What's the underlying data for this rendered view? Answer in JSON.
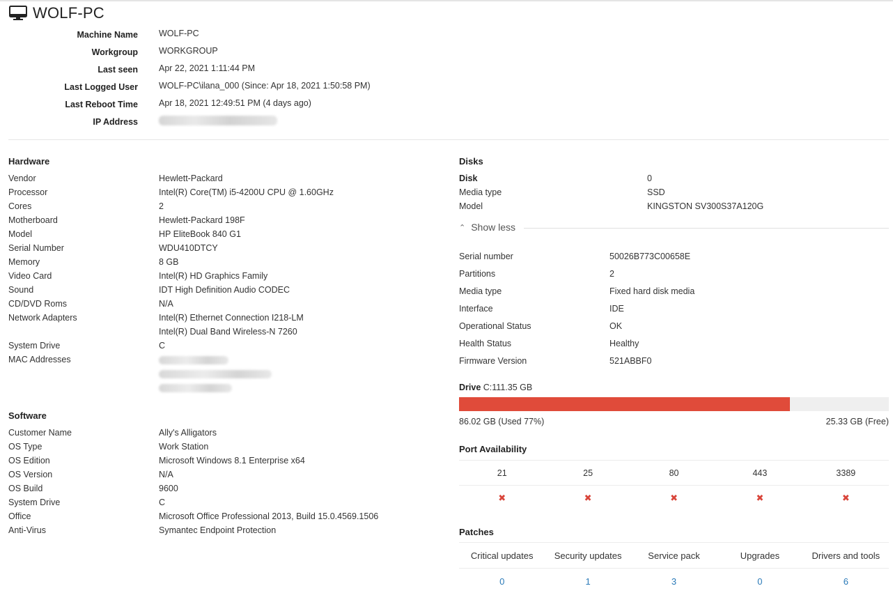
{
  "header": {
    "title": "WOLF-PC",
    "icon": "monitor-icon"
  },
  "summary": [
    {
      "label": "Machine Name",
      "value": "WOLF-PC"
    },
    {
      "label": "Workgroup",
      "value": "WORKGROUP"
    },
    {
      "label": "Last seen",
      "value": "Apr 22, 2021 1:11:44 PM"
    },
    {
      "label": "Last Logged User",
      "value": "WOLF-PC\\ilana_000 (Since: Apr 18, 2021 1:50:58 PM)"
    },
    {
      "label": "Last Reboot Time",
      "value": "Apr 18, 2021 12:49:51 PM (4 days ago)"
    },
    {
      "label": "IP Address",
      "value": ""
    }
  ],
  "hardware": {
    "title": "Hardware",
    "rows": [
      {
        "label": "Vendor",
        "value": "Hewlett-Packard"
      },
      {
        "label": "Processor",
        "value": "Intel(R) Core(TM) i5-4200U CPU @ 1.60GHz"
      },
      {
        "label": "Cores",
        "value": "2"
      },
      {
        "label": "Motherboard",
        "value": "Hewlett-Packard 198F"
      },
      {
        "label": "Model",
        "value": "HP EliteBook 840 G1"
      },
      {
        "label": "Serial Number",
        "value": "WDU410DTCY"
      },
      {
        "label": "Memory",
        "value": "8 GB"
      },
      {
        "label": "Video Card",
        "value": "Intel(R) HD Graphics Family"
      },
      {
        "label": "Sound",
        "value": "IDT High Definition Audio CODEC"
      },
      {
        "label": "CD/DVD Roms",
        "value": "N/A"
      },
      {
        "label": "Network Adapters",
        "value": "Intel(R) Ethernet Connection I218-LM"
      },
      {
        "label": "",
        "value": "Intel(R) Dual Band Wireless-N 7260"
      },
      {
        "label": "System Drive",
        "value": "C"
      },
      {
        "label": "MAC Addresses",
        "value": ""
      }
    ]
  },
  "software": {
    "title": "Software",
    "rows": [
      {
        "label": "Customer Name",
        "value": "Ally's Alligators"
      },
      {
        "label": "OS Type",
        "value": "Work Station"
      },
      {
        "label": "OS Edition",
        "value": "Microsoft Windows 8.1 Enterprise x64"
      },
      {
        "label": "OS Version",
        "value": "N/A"
      },
      {
        "label": "OS Build",
        "value": "9600"
      },
      {
        "label": "System Drive",
        "value": "C"
      },
      {
        "label": "Office",
        "value": "Microsoft Office Professional 2013, Build 15.0.4569.1506"
      },
      {
        "label": "Anti-Virus",
        "value": "Symantec Endpoint Protection"
      }
    ]
  },
  "disks": {
    "title": "Disks",
    "disk_label": "Disk",
    "disk_value": "0",
    "rows": [
      {
        "label": "Media type",
        "value": "SSD"
      },
      {
        "label": "Model",
        "value": "KINGSTON SV300S37A120G"
      }
    ],
    "show_less": "Show less",
    "details": [
      {
        "label": "Serial number",
        "value": "50026B773C00658E"
      },
      {
        "label": "Partitions",
        "value": "2"
      },
      {
        "label": "Media type",
        "value": "Fixed hard disk media"
      },
      {
        "label": "Interface",
        "value": "IDE"
      },
      {
        "label": "Operational Status",
        "value": "OK"
      },
      {
        "label": "Health Status",
        "value": "Healthy"
      },
      {
        "label": "Firmware Version",
        "value": "521ABBF0"
      }
    ]
  },
  "drive": {
    "label_bold": "Drive",
    "label_rest": "C:111.35 GB",
    "used_fraction": 0.77,
    "used_text": "86.02 GB (Used 77%)",
    "free_text": "25.33 GB (Free)",
    "bar_color": "#e04b3a"
  },
  "ports": {
    "title": "Port Availability",
    "numbers": [
      "21",
      "25",
      "80",
      "443",
      "3389"
    ],
    "status_icon": "close-icon",
    "status_color": "#d9453a"
  },
  "patches": {
    "title": "Patches",
    "headers": [
      "Critical updates",
      "Security updates",
      "Service pack",
      "Upgrades",
      "Drivers and tools"
    ],
    "counts": [
      "0",
      "1",
      "3",
      "0",
      "6"
    ],
    "count_color": "#2a7ab8"
  }
}
